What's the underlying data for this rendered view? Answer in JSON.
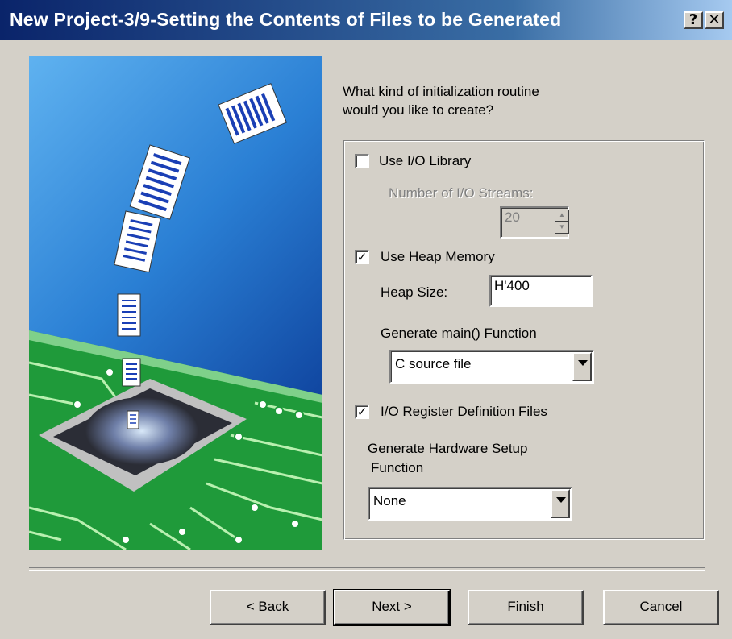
{
  "window": {
    "title": "New Project-3/9-Setting the Contents of Files to be Generated",
    "help_label": "?",
    "close_label": "✕"
  },
  "question": {
    "line1": "What kind of initialization routine",
    "line2": "would you like to create?"
  },
  "options": {
    "io_library": {
      "label": "Use I/O Library",
      "checked": false
    },
    "io_streams": {
      "label": "Number of I/O Streams:",
      "value": "20",
      "disabled": true
    },
    "heap_memory": {
      "label": "Use Heap Memory",
      "checked": true
    },
    "heap_size": {
      "label": "Heap Size:",
      "value": "H'400"
    },
    "main_function": {
      "label": "Generate main() Function",
      "selected": "C source file"
    },
    "io_register": {
      "label": "I/O Register Definition Files",
      "checked": true
    },
    "hardware_setup": {
      "label_line1": "Generate Hardware Setup",
      "label_line2": "Function",
      "selected": "None"
    }
  },
  "buttons": {
    "back": "< Back",
    "next": "Next >",
    "finish": "Finish",
    "cancel": "Cancel"
  },
  "colors": {
    "titlebar_start": "#0a246a",
    "titlebar_end": "#a6caf0",
    "dialog_bg": "#d4d0c8",
    "board_green": "#1f9a3a",
    "sky_blue": "#2a7fd4"
  }
}
